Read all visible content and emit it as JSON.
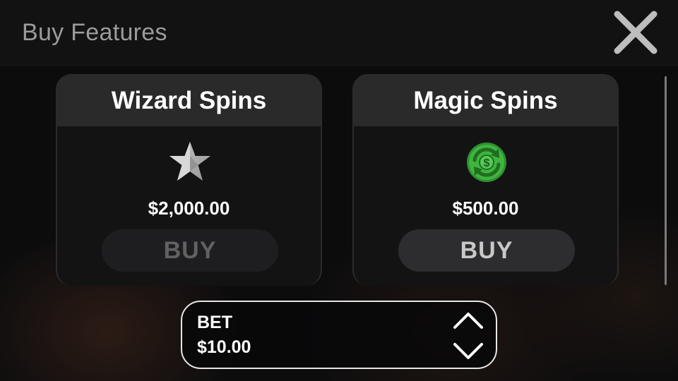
{
  "header": {
    "title": "Buy Features"
  },
  "icons": {
    "close": "close-icon",
    "star": "star-icon",
    "respin": "dollar-refresh-icon",
    "bet_up": "chevron-up-icon",
    "bet_down": "chevron-down-icon"
  },
  "features": [
    {
      "title": "Wizard Spins",
      "price": "$2,000.00",
      "buy_label": "BUY",
      "buy_enabled": false
    },
    {
      "title": "Magic Spins",
      "price": "$500.00",
      "buy_label": "BUY",
      "buy_enabled": true
    }
  ],
  "bet": {
    "label": "BET",
    "value": "$10.00"
  },
  "colors": {
    "title_text": "#9b9b9b",
    "card_header": "#2a2a2b",
    "buy_disabled_text": "#616161",
    "buy_enabled_text": "#c8c8c8",
    "icon_green": "#3fb43f"
  }
}
